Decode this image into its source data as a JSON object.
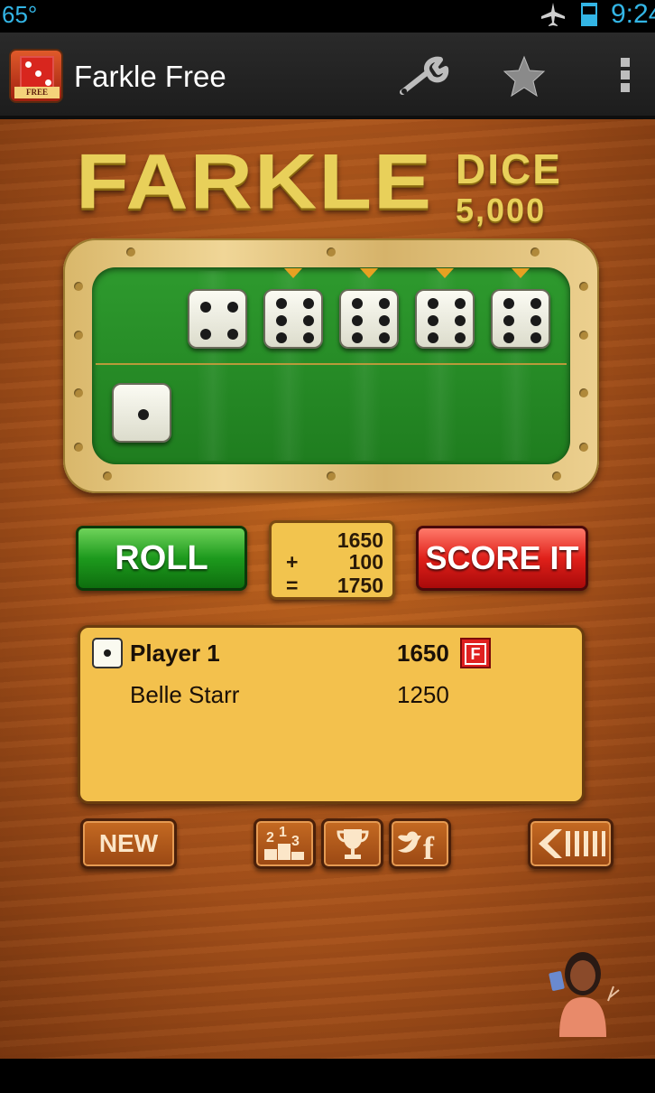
{
  "status_bar": {
    "temperature": "65°",
    "time": "9:24"
  },
  "action_bar": {
    "title": "Farkle Free",
    "icon_badge": "FREE",
    "icons": [
      "settings-wrench-icon",
      "star-icon",
      "overflow-menu-icon"
    ]
  },
  "logo": {
    "main": "FARKLE",
    "sub": "DICE",
    "target": "5,000"
  },
  "tray": {
    "active_dice": [
      4,
      6,
      6,
      6,
      6
    ],
    "held_markers_on": [
      2,
      3,
      4,
      5
    ],
    "set_aside_dice": [
      1
    ]
  },
  "buttons": {
    "roll": "ROLL",
    "score": "SCORE IT",
    "new": "NEW"
  },
  "tally": {
    "current": "1650",
    "add_op": "+",
    "add": "100",
    "eq_op": "=",
    "total": "1750"
  },
  "scoreboard": {
    "players": [
      {
        "name": "Player 1",
        "score": "1650",
        "active": true,
        "farkle_badge": "F"
      },
      {
        "name": "Belle Starr",
        "score": "1250",
        "active": false
      }
    ]
  },
  "colors": {
    "accent_status": "#33b5e5",
    "roll_green": "#1d9a1d",
    "score_red": "#e0201a",
    "panel_yellow": "#f3c14d",
    "felt_green": "#2e9a2e"
  }
}
